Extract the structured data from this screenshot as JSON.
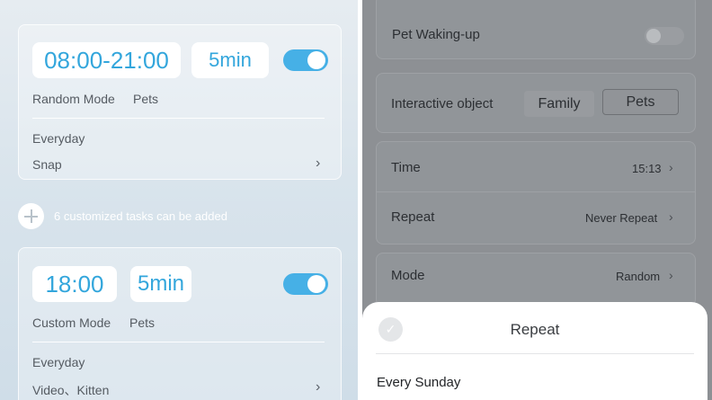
{
  "left": {
    "card1": {
      "time": "08:00-21:00",
      "duration": "5min",
      "mode": "Random Mode",
      "target": "Pets",
      "repeat": "Everyday",
      "action": "Snap"
    },
    "add_hint": "6 customized tasks can be added",
    "card2": {
      "time": "18:00",
      "duration": "5min",
      "mode": "Custom Mode",
      "target": "Pets",
      "repeat": "Everyday",
      "action": "Video、Kitten"
    }
  },
  "right": {
    "pet_waking_label": "Pet Waking-up",
    "interactive_label": "Interactive object",
    "interactive_options": [
      "Family",
      "Pets"
    ],
    "time_label": "Time",
    "time_value": "15:13",
    "repeat_label": "Repeat",
    "repeat_value": "Never Repeat",
    "mode_label": "Mode",
    "mode_value": "Random",
    "sheet": {
      "title": "Repeat",
      "first_option": "Every Sunday"
    }
  },
  "colors": {
    "accent": "#33a6dc",
    "toggle_on": "#46b0e6",
    "overlay": "#8d9094"
  },
  "icons": {
    "chevron": "chevron-right-icon",
    "add": "plus-circle-icon",
    "check": "check-circle-icon"
  }
}
